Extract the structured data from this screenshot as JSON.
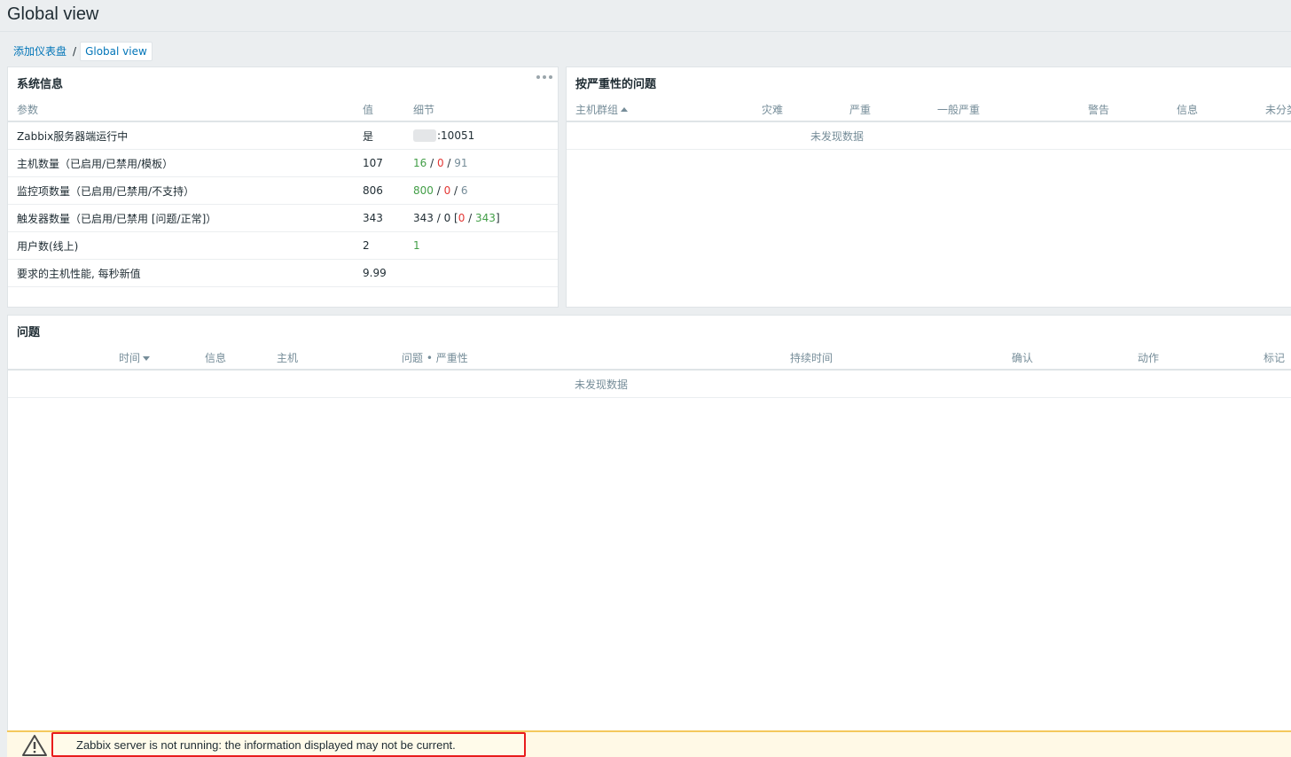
{
  "header": {
    "title": "Global view"
  },
  "breadcrumb": {
    "link": "添加仪表盘",
    "separator": "/",
    "current": "Global view"
  },
  "system_info": {
    "title": "系统信息",
    "columns": [
      "参数",
      "值",
      "细节"
    ],
    "rows": [
      {
        "param": "Zabbix服务器端运行中",
        "value": "是",
        "detail_suffix": ":10051"
      },
      {
        "param": "主机数量（已启用/已禁用/模板）",
        "value": "107",
        "d1": "16",
        "d2": "0",
        "d3": "91"
      },
      {
        "param": "监控项数量（已启用/已禁用/不支持）",
        "value": "806",
        "d1": "800",
        "d2": "0",
        "d3": "6"
      },
      {
        "param": "触发器数量（已启用/已禁用 [问题/正常]）",
        "value": "343",
        "d1": "343",
        "d2": "0",
        "d3": "0",
        "d4": "343"
      },
      {
        "param": "用户数(线上)",
        "value": "2",
        "d1": "1"
      },
      {
        "param": "要求的主机性能, 每秒新值",
        "value": "9.99"
      }
    ]
  },
  "problems_by_severity": {
    "title": "按严重性的问题",
    "columns": [
      "主机群组",
      "灾难",
      "严重",
      "一般严重",
      "警告",
      "信息",
      "未分类"
    ],
    "no_data": "未发现数据"
  },
  "problems": {
    "title": "问题",
    "columns": [
      "时间",
      "信息",
      "主机",
      "问题 • 严重性",
      "持续时间",
      "确认",
      "动作",
      "标记"
    ],
    "no_data": "未发现数据"
  },
  "message": {
    "text": "Zabbix server is not running: the information displayed may not be current."
  },
  "colors": {
    "link": "#0275b8",
    "ok": "#429e47",
    "problem": "#e33734",
    "warning_border": "#e81c1c"
  }
}
